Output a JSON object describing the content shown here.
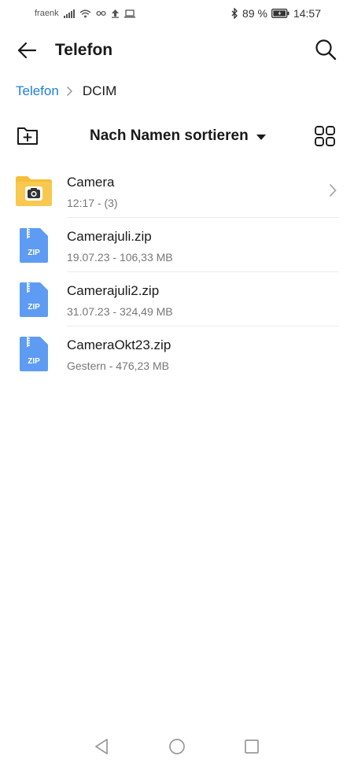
{
  "status_bar": {
    "carrier": "fraenk",
    "battery_percent": "89 %",
    "time": "14:57",
    "icons": [
      "signal-icon",
      "wifi-icon",
      "data-saver-icon",
      "upload-icon",
      "laptop-icon",
      "bluetooth-icon",
      "battery-icon"
    ]
  },
  "app_bar": {
    "title": "Telefon",
    "icons": [
      "back-arrow-icon",
      "search-icon"
    ]
  },
  "breadcrumb": {
    "items": [
      "Telefon",
      "DCIM"
    ]
  },
  "toolbar": {
    "sort_label": "Nach Namen sortieren",
    "icons": [
      "new-folder-icon",
      "sort-caret-icon",
      "grid-view-icon"
    ]
  },
  "files": [
    {
      "name": "Camera",
      "meta": "12:17 - (3)",
      "icon": "camera-folder-icon"
    },
    {
      "name": "Camerajuli.zip",
      "meta": "19.07.23 - 106,33 MB",
      "icon": "zip-file-icon",
      "badge": "ZIP"
    },
    {
      "name": "Camerajuli2.zip",
      "meta": "31.07.23 - 324,49 MB",
      "icon": "zip-file-icon",
      "badge": "ZIP"
    },
    {
      "name": "CameraOkt23.zip",
      "meta": "Gestern - 476,23 MB",
      "icon": "zip-file-icon",
      "badge": "ZIP"
    }
  ],
  "nav_bar": {
    "icons": [
      "back-triangle-icon",
      "home-circle-icon",
      "recents-square-icon"
    ]
  },
  "colors": {
    "accent": "#1f7fd6",
    "folder": "#f6be3a",
    "zip": "#5d9cf2"
  }
}
